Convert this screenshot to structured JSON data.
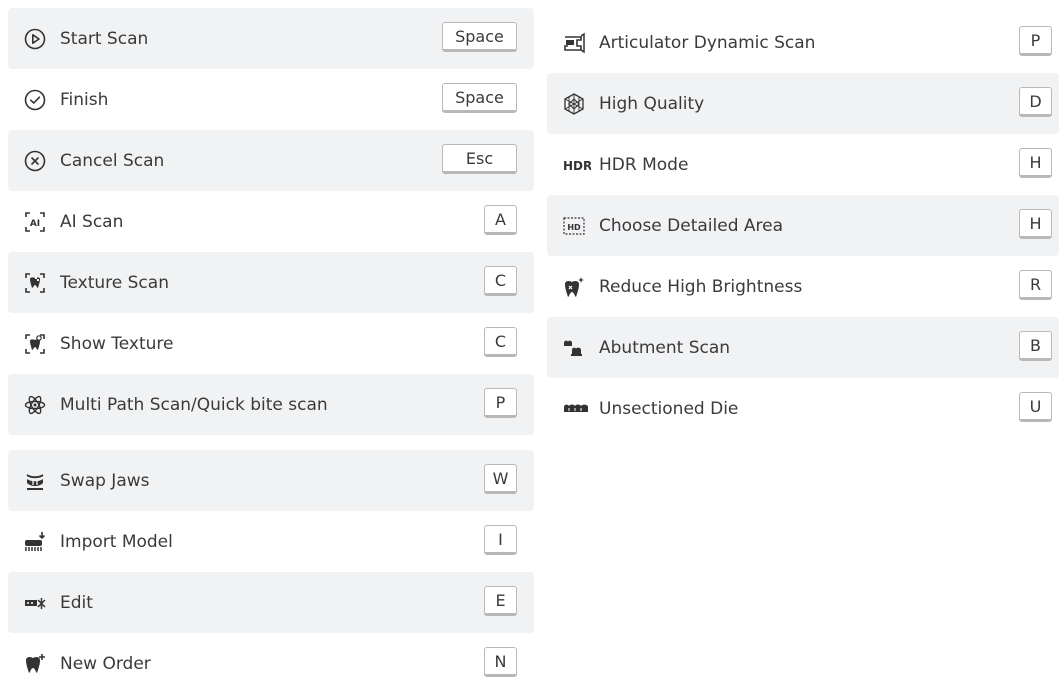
{
  "left": [
    {
      "label": "Start Scan",
      "key": "Space",
      "icon": "play-circle-icon",
      "shaded": true
    },
    {
      "label": "Finish",
      "key": "Space",
      "icon": "check-circle-icon",
      "shaded": false
    },
    {
      "label": "Cancel Scan",
      "key": "Esc",
      "icon": "x-circle-icon",
      "shaded": true
    },
    {
      "label": "AI Scan",
      "key": "A",
      "icon": "ai-scan-icon",
      "shaded": false
    },
    {
      "label": "Texture Scan",
      "key": "C",
      "icon": "texture-scan-icon",
      "shaded": true
    },
    {
      "label": "Show Texture",
      "key": "C",
      "icon": "show-texture-icon",
      "shaded": false
    },
    {
      "label": "Multi Path Scan/Quick bite scan",
      "key": "P",
      "icon": "atom-icon",
      "shaded": true
    },
    {
      "label": "Swap Jaws",
      "key": "W",
      "icon": "swap-jaws-icon",
      "shaded": true
    },
    {
      "label": "Import Model",
      "key": "I",
      "icon": "import-model-icon",
      "shaded": false
    },
    {
      "label": "Edit",
      "key": "E",
      "icon": "edit-teeth-icon",
      "shaded": true
    },
    {
      "label": "New Order",
      "key": "N",
      "icon": "tooth-plus-icon",
      "shaded": false
    }
  ],
  "right": [
    {
      "label": "Articulator Dynamic Scan",
      "key": "P",
      "icon": "articulator-icon",
      "shaded": false
    },
    {
      "label": "High Quality",
      "key": "D",
      "icon": "mesh-icon",
      "shaded": true
    },
    {
      "label": "HDR Mode",
      "key": "H",
      "icon": "hdr-icon",
      "icon_text": "HDR",
      "shaded": false
    },
    {
      "label": "Choose Detailed Area",
      "key": "H",
      "icon": "hd-area-icon",
      "icon_text": "HD",
      "shaded": true
    },
    {
      "label": "Reduce High Brightness",
      "key": "R",
      "icon": "tooth-sparkle-icon",
      "shaded": false
    },
    {
      "label": "Abutment Scan",
      "key": "B",
      "icon": "abutment-icon",
      "shaded": true
    },
    {
      "label": "Unsectioned Die",
      "key": "U",
      "icon": "unsectioned-die-icon",
      "shaded": false
    }
  ]
}
